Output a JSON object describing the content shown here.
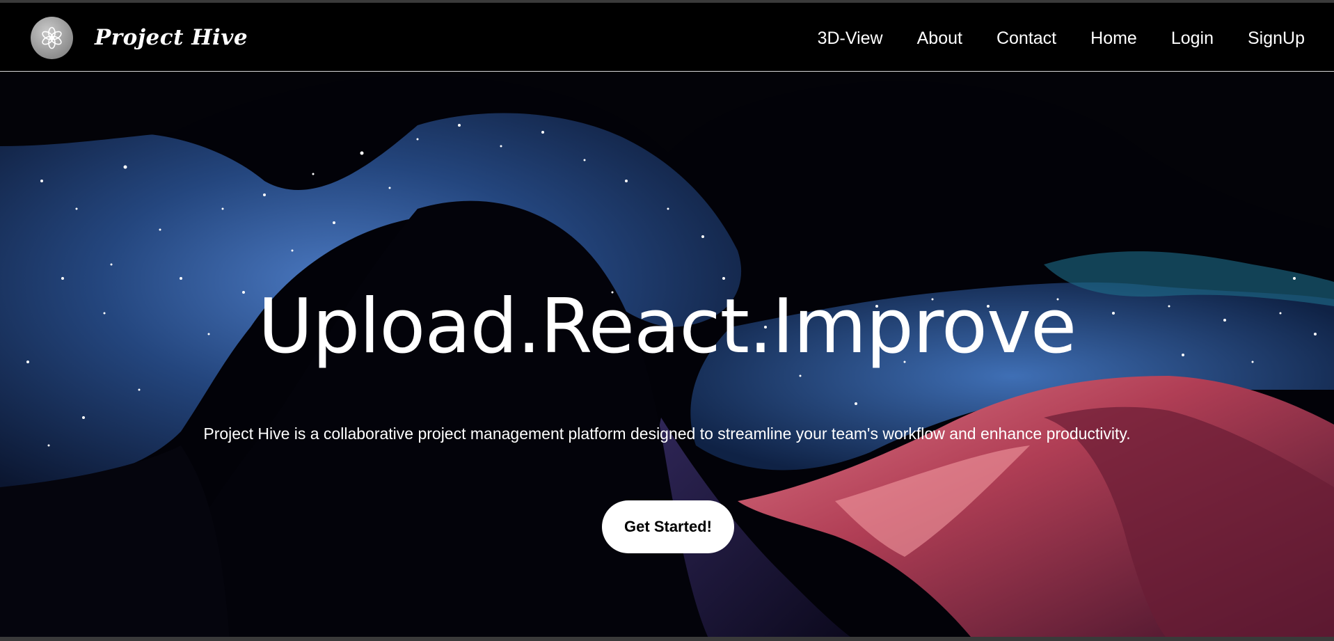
{
  "navbar": {
    "brand": "Project Hive",
    "logo_icon": "flower-icon",
    "links": [
      "3D-View",
      "About",
      "Contact",
      "Home",
      "Login",
      "SignUp"
    ]
  },
  "hero": {
    "headline": "Upload.React.Improve",
    "subtitle": "Project Hive is a collaborative project management platform designed to streamline your team's workflow and enhance productivity.",
    "cta_label": "Get Started!"
  },
  "colors": {
    "background": "#020208",
    "sky_blue": "#2e5a9a",
    "rock_red": "#c2475a",
    "text": "#ffffff",
    "button_bg": "#ffffff",
    "button_text": "#000000"
  }
}
